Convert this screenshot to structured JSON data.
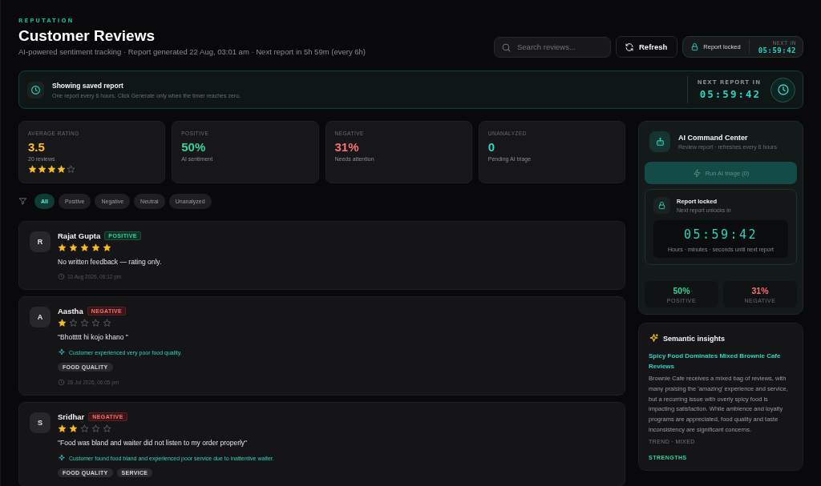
{
  "header": {
    "eyebrow": "REPUTATION",
    "title": "Customer Reviews",
    "subtitle": "AI-powered sentiment tracking · Report generated 22 Aug, 03:01 am · Next report in 5h 59m (every 6h)",
    "search": {
      "placeholder": "Search reviews..."
    },
    "refresh_button": "Refresh",
    "lock_badge": {
      "label": "Report locked",
      "caption": "NEXT IN",
      "timer": "05:59:42"
    }
  },
  "banner": {
    "title": "Showing saved report",
    "text": "One report every 6 hours. Click Generate only when the timer reaches zero.",
    "caption": "NEXT REPORT IN",
    "timer": "05:59:42"
  },
  "stats": [
    {
      "label": "AVERAGE RATING",
      "value": "3.5",
      "caption": "20 reviews",
      "kind": "rating",
      "stars": 4
    },
    {
      "label": "POSITIVE",
      "value": "50%",
      "caption": "AI sentiment",
      "kind": "positive"
    },
    {
      "label": "NEGATIVE",
      "value": "31%",
      "caption": "Needs attention",
      "kind": "negative"
    },
    {
      "label": "UNANALYZED",
      "value": "0",
      "caption": "Pending AI triage",
      "kind": "pending"
    }
  ],
  "filters": [
    {
      "label": "All",
      "selected": true
    },
    {
      "label": "Positive",
      "selected": false
    },
    {
      "label": "Negative",
      "selected": false
    },
    {
      "label": "Neutral",
      "selected": false
    },
    {
      "label": "Unanalyzed",
      "selected": false
    }
  ],
  "reviews": [
    {
      "initial": "R",
      "name": "Rajat Gupta",
      "sentiment": {
        "label": "POSITIVE",
        "kind": "positive"
      },
      "stars": 5,
      "text": "No written feedback — rating only.",
      "date": "10 Aug 2026, 06:12 pm"
    },
    {
      "initial": "A",
      "name": "Aastha",
      "sentiment": {
        "label": "NEGATIVE",
        "kind": "negative"
      },
      "stars": 1,
      "text": "\"Bhottttt hi kojo khano \"",
      "summary": "Customer experienced very poor food quality.",
      "tags": [
        "FOOD QUALITY"
      ],
      "date": "28 Jul 2026, 06:05 pm"
    },
    {
      "initial": "S",
      "name": "Sridhar",
      "sentiment": {
        "label": "NEGATIVE",
        "kind": "negative"
      },
      "stars": 2,
      "text": "\"Food was bland and waiter did not listen to my order properly\"",
      "summary": "Customer found food bland and experienced poor service due to inattentive waiter.",
      "tags": [
        "FOOD QUALITY",
        "SERVICE"
      ]
    }
  ],
  "command_center": {
    "title": "AI Command Center",
    "subtitle": "Review report · refreshes every 6 hours",
    "button": {
      "label": "Run AI triage (0)",
      "disabled": true
    },
    "lock": {
      "title": "Report locked",
      "subtitle": "Next report unlocks in",
      "timer": "05:59:42",
      "caption": "Hours · minutes · seconds until next report"
    },
    "metrics": [
      {
        "value": "50%",
        "label": "POSITIVE",
        "kind": "positive"
      },
      {
        "value": "31%",
        "label": "NEGATIVE",
        "kind": "negative"
      }
    ]
  },
  "insights": {
    "title": "Semantic insights",
    "headline": "Spicy Food Dominates Mixed Brownie Cafe Reviews",
    "body": "Brownie Cafe receives a mixed bag of reviews, with many praising the 'amazing' experience and service, but a recurring issue with overly spicy food is impacting satisfaction. While ambience and loyalty programs are appreciated, food quality and taste inconsistency are significant concerns.",
    "trend": "TREND · MIXED",
    "section": "STRENGTHS"
  }
}
